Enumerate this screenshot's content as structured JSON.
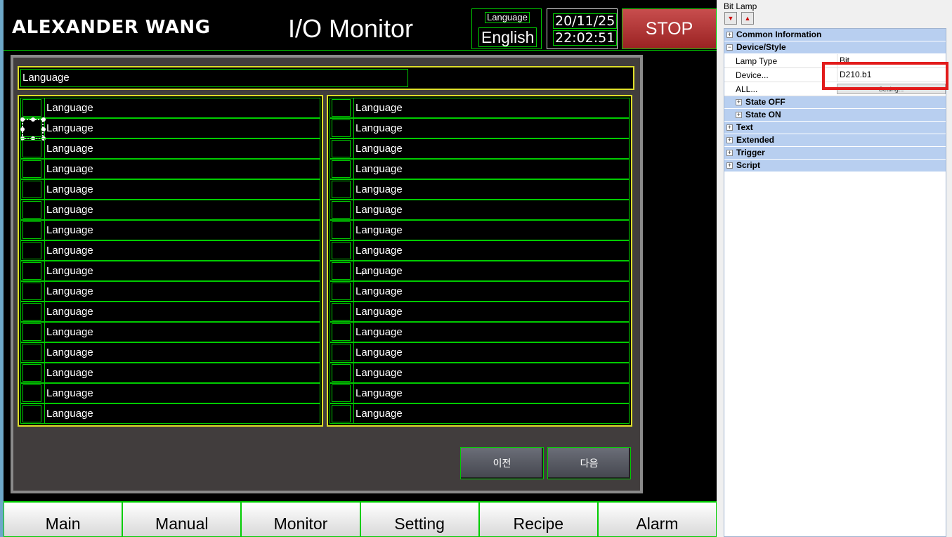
{
  "header": {
    "brand": "ALEXANDER WANG",
    "title": "I/O Monitor",
    "language_caption": "Language",
    "language_value": "English",
    "date": "20/11/25",
    "time": "22:02:51",
    "stop_label": "STOP"
  },
  "io_panel": {
    "language_row_label": "Language",
    "left_column": [
      "Language",
      "Language",
      "Language",
      "Language",
      "Language",
      "Language",
      "Language",
      "Language",
      "Language",
      "Language",
      "Language",
      "Language",
      "Language",
      "Language",
      "Language",
      "Language"
    ],
    "right_column": [
      "Language",
      "Language",
      "Language",
      "Language",
      "Language",
      "Language",
      "Language",
      "Language",
      "Language",
      "Language",
      "Language",
      "Language",
      "Language",
      "Language",
      "Language",
      "Language"
    ],
    "prev_label": "이전",
    "next_label": "다음"
  },
  "tabs": [
    "Main",
    "Manual",
    "Monitor",
    "Setting",
    "Recipe",
    "Alarm"
  ],
  "properties": {
    "title": "Bit Lamp",
    "groups": {
      "common": "Common Information",
      "device_style": "Device/Style",
      "state_off": "State OFF",
      "state_on": "State ON",
      "text": "Text",
      "extended": "Extended",
      "trigger": "Trigger",
      "script": "Script"
    },
    "rows": {
      "lamp_type_name": "Lamp Type",
      "lamp_type_value": "Bit",
      "device_name": "Device...",
      "device_value": "D210.b1",
      "all_name": "ALL...",
      "all_button": "Setting..."
    }
  },
  "colors": {
    "hmi_border": "#00cc00",
    "highlight_frame": "#dede2a",
    "stop_button": "#b33a3a",
    "panel_background": "#413d3d",
    "property_group": "#b8cff0",
    "annotation_red": "#e21b1b"
  }
}
